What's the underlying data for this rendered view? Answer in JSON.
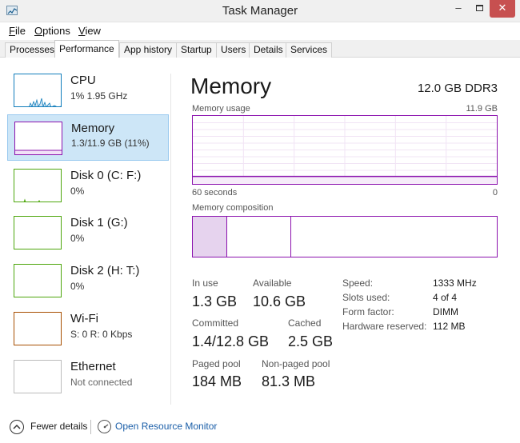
{
  "window": {
    "title": "Task Manager",
    "minimize": "–",
    "close": "✕"
  },
  "menu": [
    "File",
    "Options",
    "View"
  ],
  "tabs": [
    "Processes",
    "Performance",
    "App history",
    "Startup",
    "Users",
    "Details",
    "Services"
  ],
  "sidebar": [
    {
      "name": "CPU",
      "sub": "1% 1.95 GHz",
      "color": "#117dbb"
    },
    {
      "name": "Memory",
      "sub": "1.3/11.9 GB (11%)",
      "color": "#8b12ae"
    },
    {
      "name": "Disk 0 (C: F:)",
      "sub": "0%",
      "color": "#4da60c"
    },
    {
      "name": "Disk 1 (G:)",
      "sub": "0%",
      "color": "#4da60c"
    },
    {
      "name": "Disk 2 (H: T:)",
      "sub": "0%",
      "color": "#4da60c"
    },
    {
      "name": "Wi-Fi",
      "sub": "S: 0 R: 0 Kbps",
      "color": "#a74f01"
    },
    {
      "name": "Ethernet",
      "sub": "Not connected",
      "color": "#bbbbbb"
    }
  ],
  "memory": {
    "title": "Memory",
    "spec": "12.0 GB DDR3",
    "usage_label": "Memory usage",
    "usage_max": "11.9 GB",
    "time_left": "60 seconds",
    "time_right": "0",
    "composition_label": "Memory composition",
    "usage_fraction": 0.11,
    "stats": {
      "in_use_label": "In use",
      "in_use": "1.3 GB",
      "available_label": "Available",
      "available": "10.6 GB",
      "committed_label": "Committed",
      "committed": "1.4/12.8 GB",
      "cached_label": "Cached",
      "cached": "2.5 GB",
      "paged_label": "Paged pool",
      "paged": "184 MB",
      "nonpaged_label": "Non-paged pool",
      "nonpaged": "81.3 MB"
    },
    "props": [
      {
        "label": "Speed:",
        "value": "1333 MHz"
      },
      {
        "label": "Slots used:",
        "value": "4 of 4"
      },
      {
        "label": "Form factor:",
        "value": "DIMM"
      },
      {
        "label": "Hardware reserved:",
        "value": "112 MB"
      }
    ]
  },
  "footer": {
    "fewer_details": "Fewer details",
    "open_resource_monitor": "Open Resource Monitor"
  },
  "colors": {
    "memory": "#8b12ae",
    "cpu": "#117dbb",
    "selection": "#cde6f7",
    "link": "#1a5ea8"
  }
}
